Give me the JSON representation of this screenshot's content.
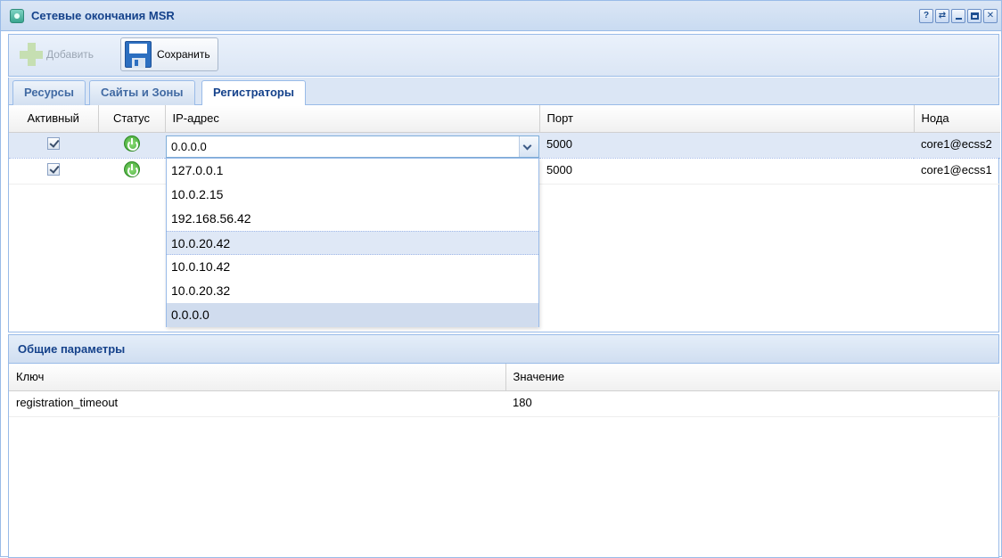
{
  "window": {
    "title": "Сетевые окончания MSR",
    "tools": [
      "?",
      "⇄"
    ]
  },
  "toolbar": {
    "add_label": "Добавить",
    "save_label": "Сохранить"
  },
  "tabs": [
    {
      "label": "Ресурсы",
      "active": false
    },
    {
      "label": "Сайты и Зоны",
      "active": false
    },
    {
      "label": "Регистраторы",
      "active": true
    }
  ],
  "registrars": {
    "columns": [
      "Активный",
      "Статус",
      "IP-адрес",
      "Порт",
      "Нода"
    ],
    "rows": [
      {
        "active": true,
        "ip": "0.0.0.0",
        "port": "5000",
        "node": "core1@ecss2"
      },
      {
        "active": true,
        "ip": "",
        "port": "5000",
        "node": "core1@ecss1"
      }
    ],
    "ip_combo": {
      "value": "0.0.0.0",
      "options": [
        "127.0.0.1",
        "10.0.2.15",
        "192.168.56.42",
        "10.0.20.42",
        "10.0.10.42",
        "10.0.20.32",
        "0.0.0.0"
      ]
    }
  },
  "params": {
    "title": "Общие параметры",
    "columns": [
      "Ключ",
      "Значение"
    ],
    "rows": [
      {
        "key": "registration_timeout",
        "value": "180"
      }
    ]
  },
  "colors": {
    "accent": "#15428b",
    "border": "#99bbe8",
    "selection": "#dfe8f6"
  }
}
